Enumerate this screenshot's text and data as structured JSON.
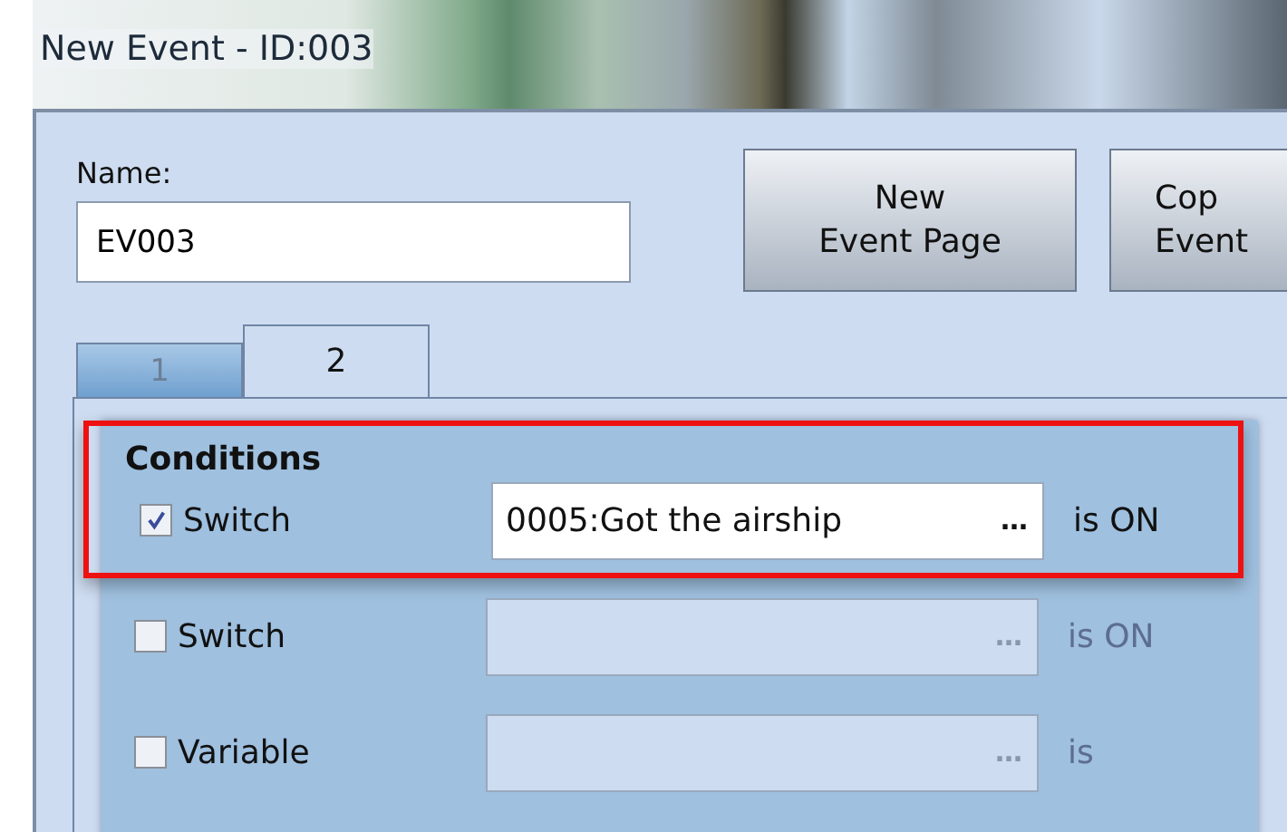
{
  "window": {
    "title": "New Event - ID:003"
  },
  "name_field": {
    "label": "Name:",
    "value": "EV003"
  },
  "buttons": [
    {
      "lines": [
        "New",
        "Event Page"
      ]
    },
    {
      "lines": [
        "Cop",
        "Event"
      ]
    }
  ],
  "tabs": [
    {
      "label": "1",
      "selected": false
    },
    {
      "label": "2",
      "selected": true
    }
  ],
  "conditions": {
    "title": "Conditions",
    "highlighted": true,
    "rows": [
      {
        "label": "Switch",
        "checked": true,
        "value": "0005:Got the airship",
        "picker": "…",
        "suffix": "is ON"
      },
      {
        "label": "Switch",
        "checked": false,
        "picker": "…",
        "suffix": "is ON"
      },
      {
        "label": "Variable",
        "checked": false,
        "picker": "…",
        "suffix": "is"
      }
    ]
  }
}
